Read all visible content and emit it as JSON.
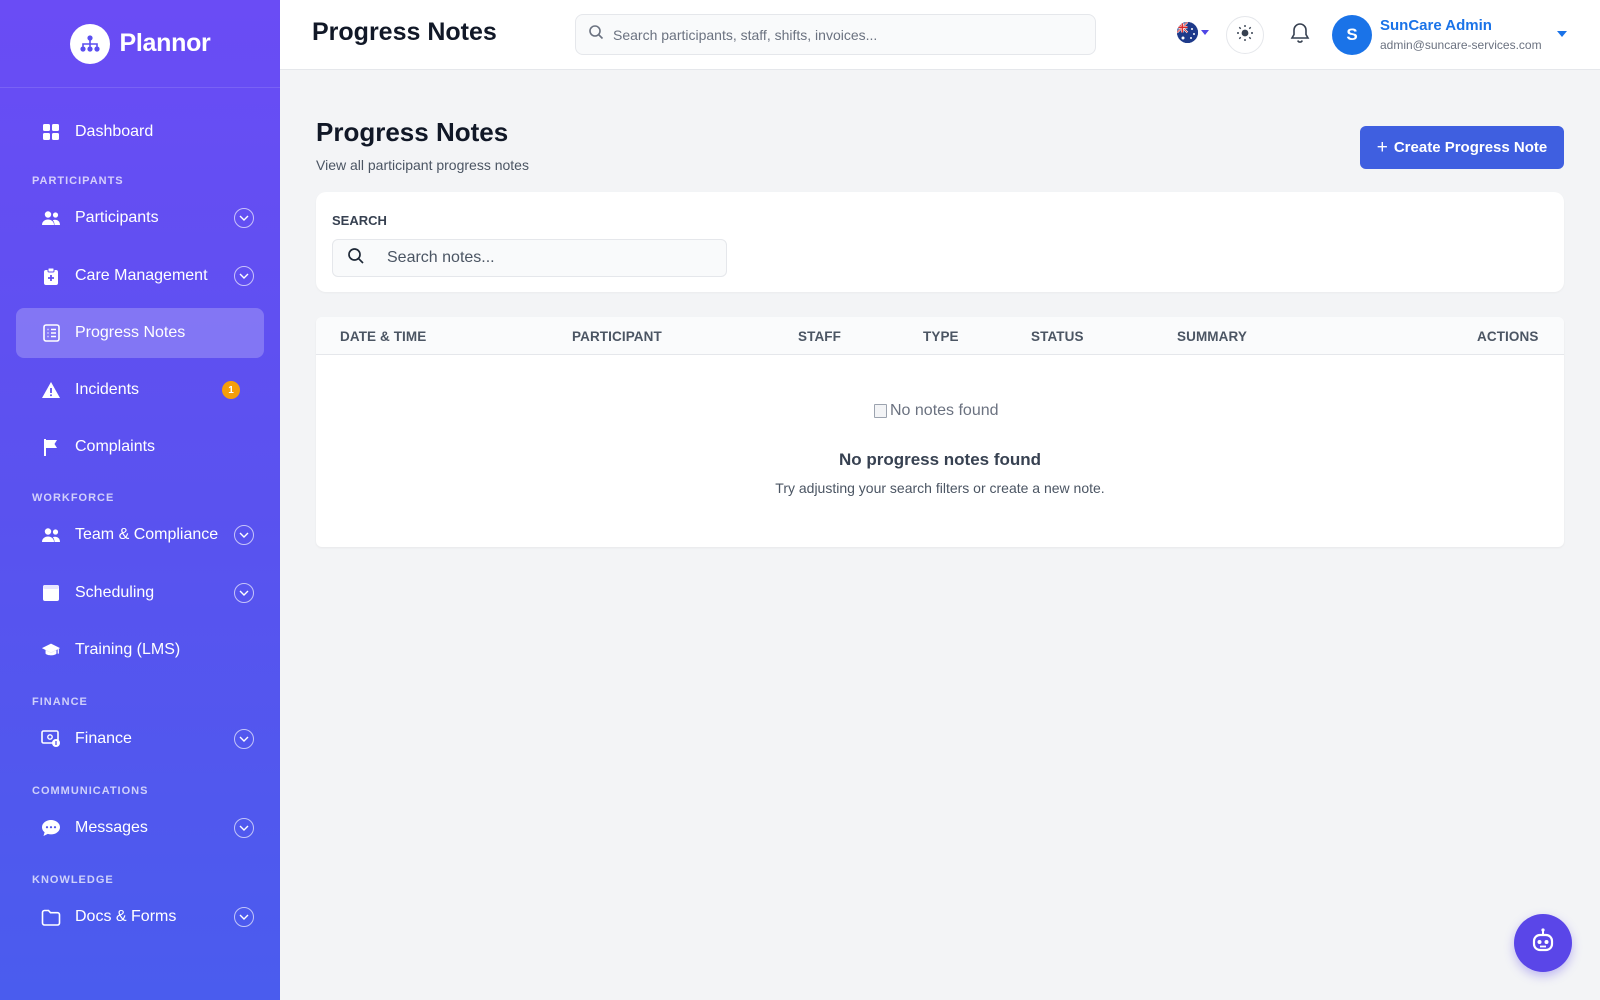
{
  "brand": {
    "name": "Plannor"
  },
  "sidebar": {
    "dashboard": "Dashboard",
    "sections": {
      "participants": "PARTICIPANTS",
      "workforce": "WORKFORCE",
      "finance": "FINANCE",
      "communications": "COMMUNICATIONS",
      "knowledge": "KNOWLEDGE"
    },
    "items": {
      "participants": "Participants",
      "care_management": "Care Management",
      "progress_notes": "Progress Notes",
      "incidents": "Incidents",
      "incidents_badge": "1",
      "complaints": "Complaints",
      "team_compliance": "Team & Compliance",
      "scheduling": "Scheduling",
      "training": "Training (LMS)",
      "finance": "Finance",
      "messages": "Messages",
      "docs_forms": "Docs & Forms"
    },
    "active": "progress_notes"
  },
  "header": {
    "title": "Progress Notes",
    "search_placeholder": "Search participants, staff, shifts, invoices...",
    "user": {
      "initial": "S",
      "name": "SunCare Admin",
      "email": "admin@suncare-services.com"
    }
  },
  "main": {
    "heading": "Progress Notes",
    "subheading": "View all participant progress notes",
    "create_button": "Create Progress Note",
    "search_label": "SEARCH",
    "search_placeholder": "Search notes...",
    "table": {
      "columns": [
        "DATE & TIME",
        "PARTICIPANT",
        "STAFF",
        "TYPE",
        "STATUS",
        "SUMMARY",
        "ACTIONS"
      ],
      "empty_image_alt": "No notes found",
      "empty_title": "No progress notes found",
      "empty_subtitle": "Try adjusting your search filters or create a new note."
    }
  },
  "colors": {
    "sidebar_top": "#6a4cf5",
    "sidebar_bottom": "#4a5cee",
    "primary_button": "#3f5fe0",
    "user_accent": "#1a73e8",
    "badge": "#f59e0b"
  }
}
